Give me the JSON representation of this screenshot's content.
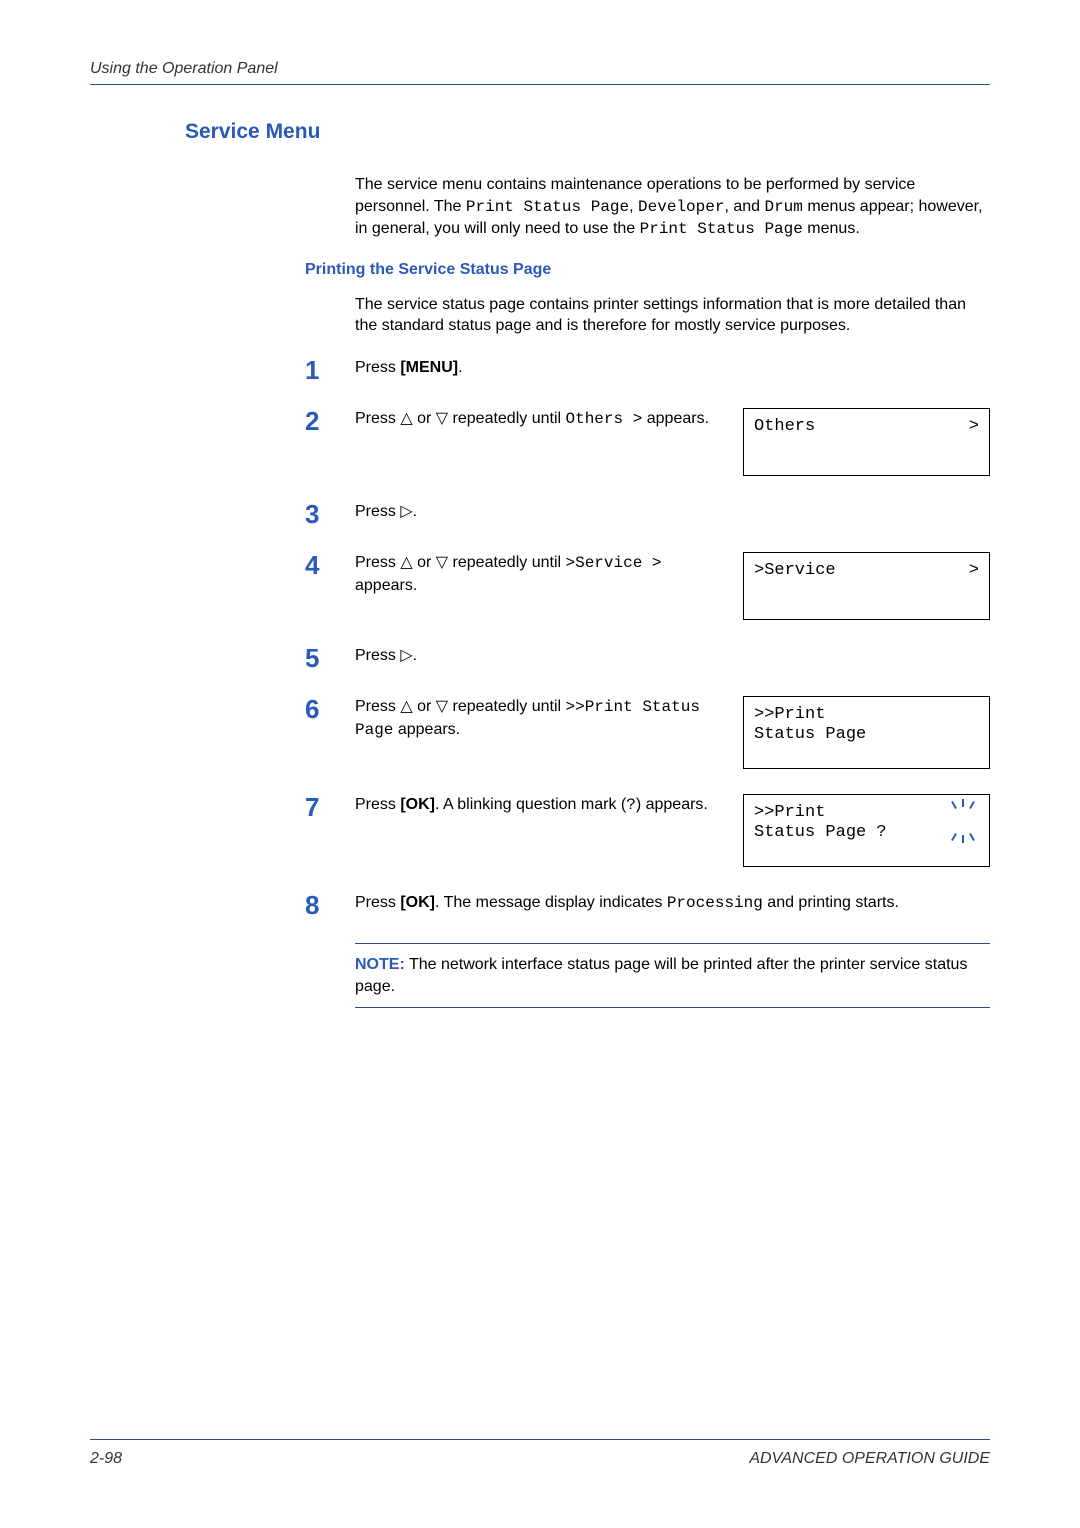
{
  "header": "Using the Operation Panel",
  "section_title": "Service Menu",
  "intro": {
    "pre1": "The service menu contains maintenance operations to be performed by service personnel. The ",
    "m1": "Print Status Page",
    "mid1": ", ",
    "m2": "Developer",
    "mid2": ", and ",
    "m3": "Drum",
    "mid3": " menus appear; however, in general, you will only need to use the ",
    "m4": "Print Status Page",
    "post": " menus."
  },
  "subsection_title": "Printing the Service Status Page",
  "subintro": "The service status page contains printer settings information that is more detailed than the standard status page and is therefore for mostly service purposes.",
  "steps": {
    "s1": {
      "num": "1",
      "a": "Press ",
      "b": "[MENU]",
      "c": "."
    },
    "s2": {
      "num": "2",
      "a": "Press ",
      "up": "△",
      "mid": " or ",
      "dn": "▽",
      "b": " repeatedly until ",
      "code": "Others >",
      "c": " appears."
    },
    "s3": {
      "num": "3",
      "a": "Press ",
      "rt": "▷",
      "b": "."
    },
    "s4": {
      "num": "4",
      "a": "Press ",
      "up": "△",
      "mid": " or ",
      "dn": "▽",
      "b": " repeatedly until ",
      "code": ">Service >",
      "c": " appears."
    },
    "s5": {
      "num": "5",
      "a": "Press ",
      "rt": "▷",
      "b": "."
    },
    "s6": {
      "num": "6",
      "a": "Press ",
      "up": "△",
      "mid": " or ",
      "dn": "▽",
      "b": " repeatedly until ",
      "code": ">>Print Status Page",
      "c": " appears."
    },
    "s7": {
      "num": "7",
      "a": "Press ",
      "ok": "[OK]",
      "b": ". A blinking question mark (",
      "q": "?",
      "c": ") appears."
    },
    "s8": {
      "num": "8",
      "a": "Press ",
      "ok": "[OK]",
      "b": ". The message display indicates ",
      "code": "Processing",
      "c": " and printing starts."
    }
  },
  "lcd": {
    "d2": {
      "line1": "Others",
      "arrow": ">"
    },
    "d4": {
      "line1": ">Service",
      "arrow": ">"
    },
    "d6": {
      "line1": ">>Print",
      "line2": " Status Page"
    },
    "d7": {
      "line1": ">>Print",
      "line2": " Status Page ?"
    }
  },
  "note": {
    "label": "NOTE:",
    "text": " The network interface status page will be printed after the printer service status page."
  },
  "footer": {
    "left": "2-98",
    "right": "ADVANCED OPERATION GUIDE"
  }
}
